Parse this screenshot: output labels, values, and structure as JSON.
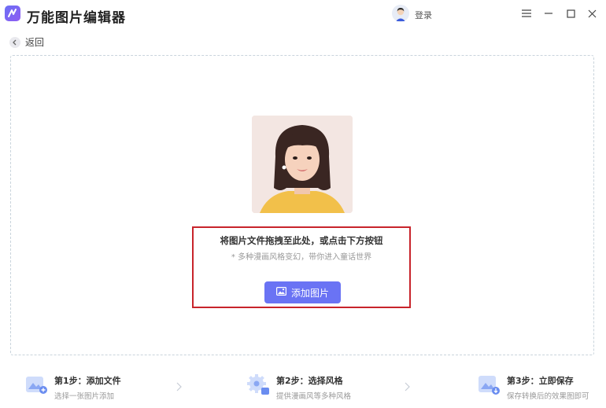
{
  "app": {
    "title": "万能图片编辑器",
    "login_label": "登录"
  },
  "icons": {
    "logo": "app-logo-icon",
    "user": "user-avatar-icon",
    "menu": "hamburger-menu-icon",
    "minimize": "minimize-icon",
    "maximize": "maximize-icon",
    "close": "close-icon",
    "back": "chevron-left-icon",
    "add_image": "image-icon"
  },
  "nav": {
    "back_label": "返回"
  },
  "upload": {
    "headline": "将图片文件拖拽至此处，或点击下方按钮",
    "subline": "* 多种漫画风格变幻，带你进入童话世界",
    "button_label": "添加图片"
  },
  "steps": [
    {
      "title": "第1步：添加文件",
      "desc": "选择一张图片添加"
    },
    {
      "title": "第2步：选择风格",
      "desc": "提供漫画风等多种风格"
    },
    {
      "title": "第3步：立即保存",
      "desc": "保存转换后的效果图即可"
    }
  ],
  "colors": {
    "accent": "#6a73f4",
    "highlight_border": "#c8242b",
    "dashed_border": "#c9d4dc"
  }
}
